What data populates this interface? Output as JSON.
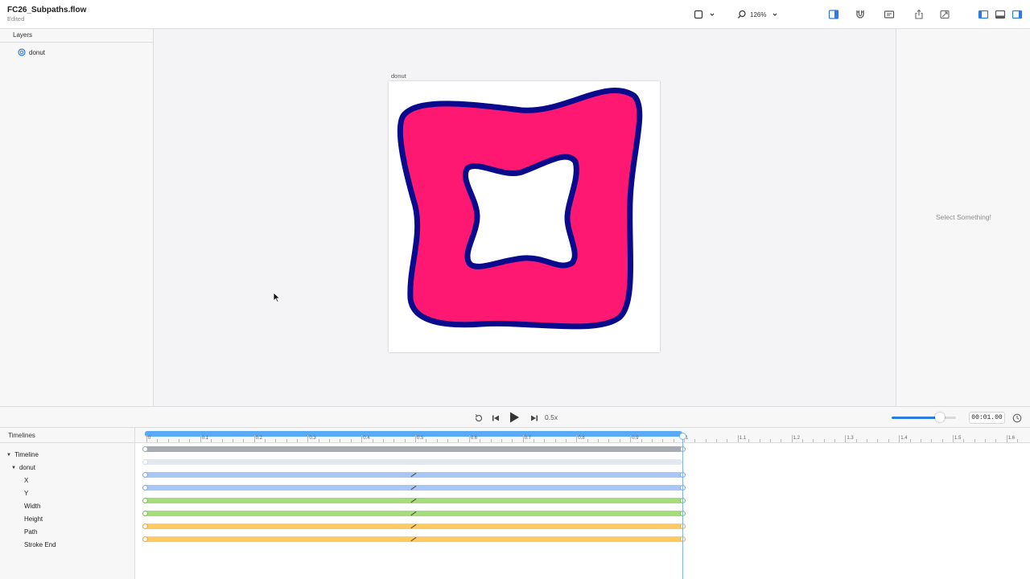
{
  "window": {
    "title": "FC26_Subpaths.flow",
    "subtitle": "Edited"
  },
  "toolbar": {
    "zoom": "126%",
    "icons": [
      "shape-tool-icon",
      "chevron-down-icon",
      "search-icon",
      "inspector-toggle-icon",
      "magnet-icon",
      "comment-icon",
      "share-icon",
      "export-icon",
      "left-panel-icon",
      "bottom-panel-icon",
      "right-panel-icon"
    ]
  },
  "layers": {
    "header": "Layers",
    "items": [
      {
        "label": "donut"
      }
    ]
  },
  "canvas": {
    "artboard_label": "donut",
    "colors": {
      "fill": "#ff1872",
      "stroke": "#0a0a8c",
      "background": "#ffffff"
    }
  },
  "inspector": {
    "empty_message": "Select Something!"
  },
  "transport": {
    "speed": "0.5x",
    "time": "00:01.00",
    "volume_level": 0.75
  },
  "timelines": {
    "header": "Timelines",
    "tree": {
      "root": "Timeline",
      "layer": "donut",
      "properties": [
        "X",
        "Y",
        "Width",
        "Height",
        "Path",
        "Stroke End"
      ]
    },
    "ruler_labels": [
      "0",
      "0.1",
      "0.2",
      "0.3",
      "0.4",
      "0.5",
      "0.6",
      "0.7",
      "0.8",
      "0.9",
      "1",
      "1.1",
      "1.2",
      "1.3",
      "1.4",
      "1.5",
      "1.6"
    ],
    "playhead_time": 1.0,
    "duration": 1.0,
    "track_colors": {
      "group": "#a8abb2",
      "layer": "#e3e7ee",
      "position": "#a9c7f4",
      "size": "#a6dc79",
      "path": "#ffca64"
    }
  }
}
